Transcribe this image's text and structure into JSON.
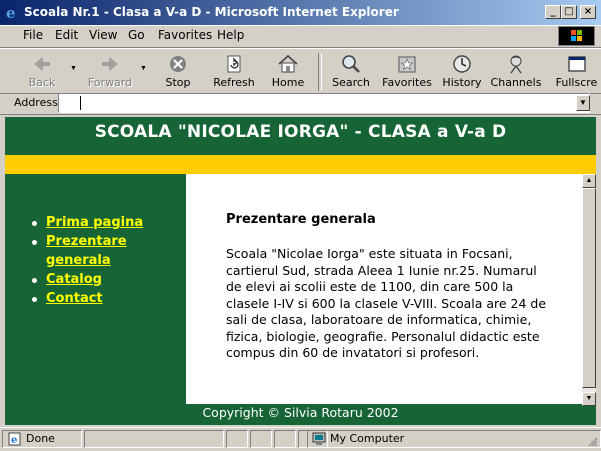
{
  "window": {
    "title": "Scoala Nr.1 - Clasa a V-a D - Microsoft Internet Explorer",
    "minimize": "_",
    "maximize": "□",
    "close": "×"
  },
  "menu": {
    "items": [
      "File",
      "Edit",
      "View",
      "Go",
      "Favorites",
      "Help"
    ]
  },
  "toolbar": {
    "buttons": [
      {
        "label": "Back",
        "icon": "back-arrow-icon",
        "enabled": false
      },
      {
        "label": "Forward",
        "icon": "forward-arrow-icon",
        "enabled": false
      },
      {
        "label": "Stop",
        "icon": "stop-icon",
        "enabled": true
      },
      {
        "label": "Refresh",
        "icon": "refresh-icon",
        "enabled": true
      },
      {
        "label": "Home",
        "icon": "home-icon",
        "enabled": true
      },
      {
        "label": "Search",
        "icon": "search-icon",
        "enabled": true
      },
      {
        "label": "Favorites",
        "icon": "favorites-icon",
        "enabled": true
      },
      {
        "label": "History",
        "icon": "history-icon",
        "enabled": true
      },
      {
        "label": "Channels",
        "icon": "channels-icon",
        "enabled": true
      },
      {
        "label": "Fullscre",
        "icon": "fullscreen-icon",
        "enabled": true
      }
    ]
  },
  "address": {
    "label": "Address",
    "value": ""
  },
  "page": {
    "title": "SCOALA \"NICOLAE IORGA\" - CLASA a V-a D",
    "nav": [
      "Prima pagina",
      "Prezentare generala",
      "Catalog",
      "Contact"
    ],
    "heading": "Prezentare generala",
    "body": "Scoala \"Nicolae Iorga\" este situata in Focsani, cartierul Sud, strada Aleea 1 Iunie nr.25. Numarul de elevi ai scolii este de 1100, din care 500 la clasele I-IV si 600 la clasele V-VIII. Scoala are 24 de sali de clasa, laboratoare de informatica, chimie, fizica, biologie, geografie. Personalul didactic este compus din 60 de invatatori si profesori.",
    "footer": "Copyright © Silvia Rotaru 2002"
  },
  "status": {
    "text": "Done",
    "zone": "My Computer"
  },
  "colors": {
    "page_green": "#176537",
    "band_yellow": "#ffcc00",
    "link_yellow": "#ffff00"
  }
}
